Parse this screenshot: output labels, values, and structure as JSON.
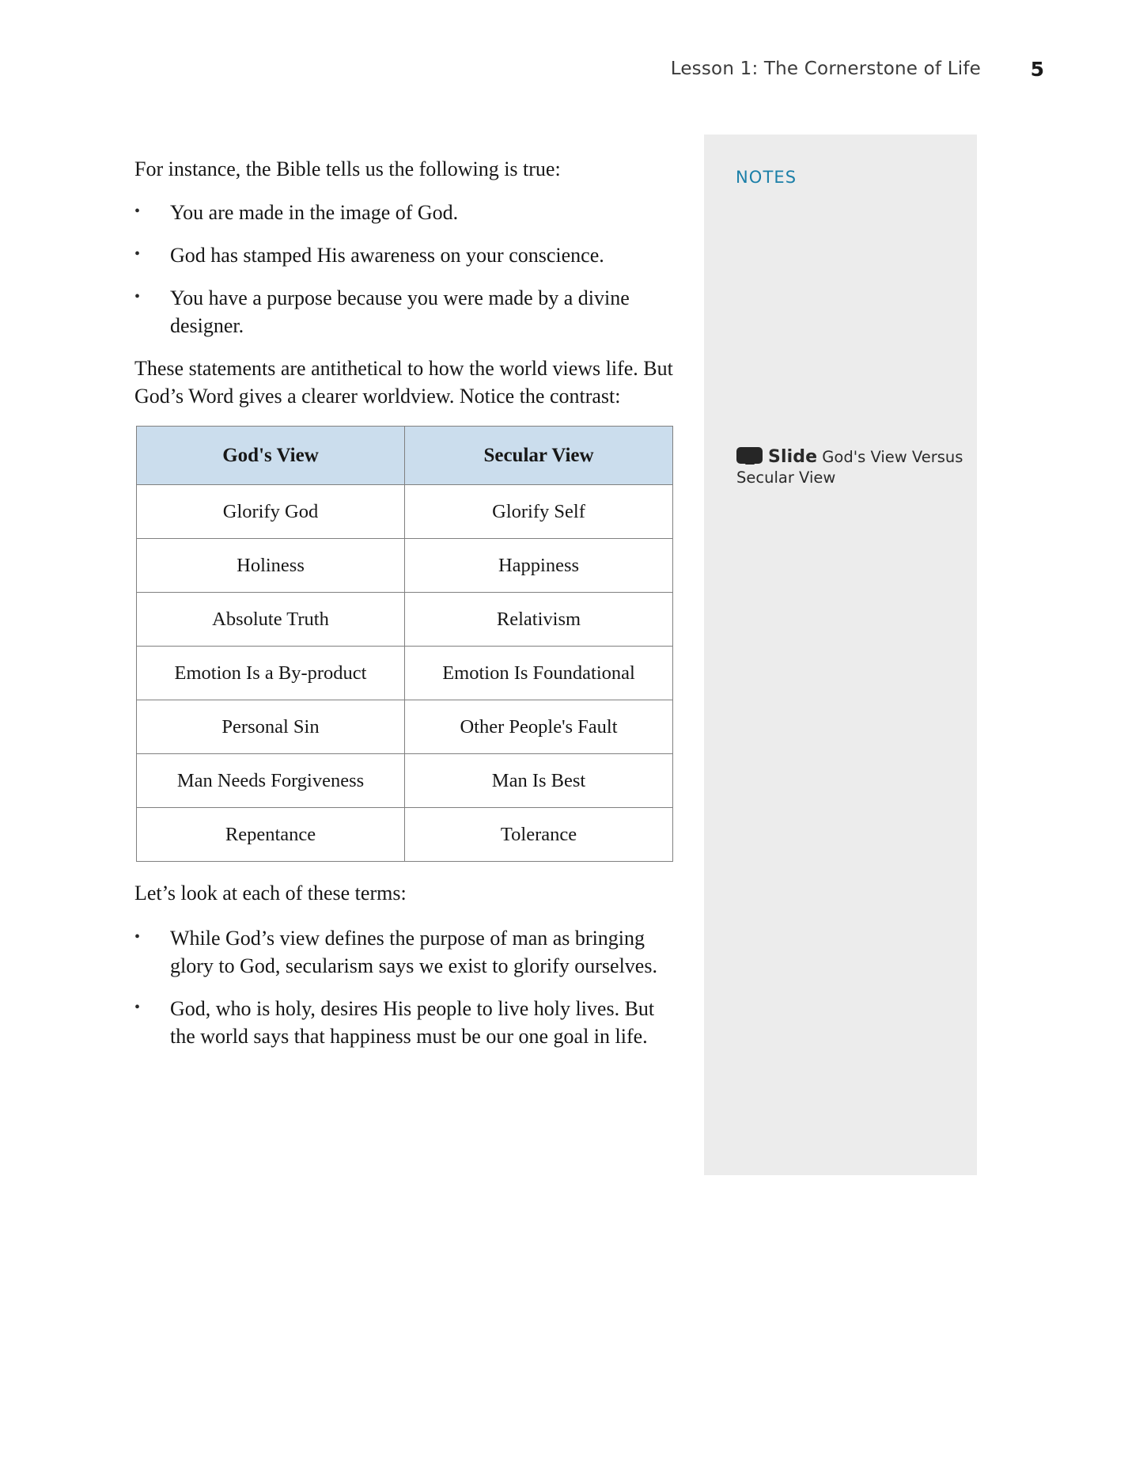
{
  "header": {
    "title": "Lesson 1: The Cornerstone of Life",
    "page_number": "5"
  },
  "notes": {
    "heading": "NOTES",
    "slide_icon_name": "slide-projector-icon",
    "slide_label": "Slide",
    "slide_title": " God's View Versus Secular View"
  },
  "main": {
    "intro_paragraph": "For instance, the Bible tells us the following is true:",
    "intro_bullets": [
      "You are made in the image of God.",
      "God has stamped His awareness on your conscience.",
      "You have a purpose because you were made by a divine designer."
    ],
    "contrast_paragraph": "These statements are antithetical to how the world views life. But God’s Word gives a clearer worldview. Notice the contrast:",
    "terms_paragraph": "Let’s look at each of these terms:",
    "closing_bullets": [
      "While God’s view defines the purpose of man as bringing glory to God, secularism says we exist to glorify ourselves.",
      "God, who is holy, desires His people to live holy lives. But the world says that happiness must be our one goal in life."
    ],
    "bullet_glyph": "•"
  },
  "table": {
    "headers": [
      "God's View",
      "Secular View"
    ],
    "header_fill": "#cbdded",
    "border_color": "#808080",
    "rows": [
      {
        "gods_view": "Glorify God",
        "secular_view": "Glorify Self"
      },
      {
        "gods_view": "Holiness",
        "secular_view": "Happiness"
      },
      {
        "gods_view": "Absolute Truth",
        "secular_view": "Relativism"
      },
      {
        "gods_view": "Emotion Is a By-product",
        "secular_view": "Emotion Is Foundational"
      },
      {
        "gods_view": "Personal Sin",
        "secular_view": "Other People's Fault"
      },
      {
        "gods_view": "Man Needs Forgiveness",
        "secular_view": "Man Is Best"
      },
      {
        "gods_view": "Repentance",
        "secular_view": "Tolerance"
      }
    ]
  },
  "colors": {
    "notes_accent": "#1b7fa8",
    "notes_panel_bg": "#ececec",
    "table_header_bg": "#cbdded"
  }
}
